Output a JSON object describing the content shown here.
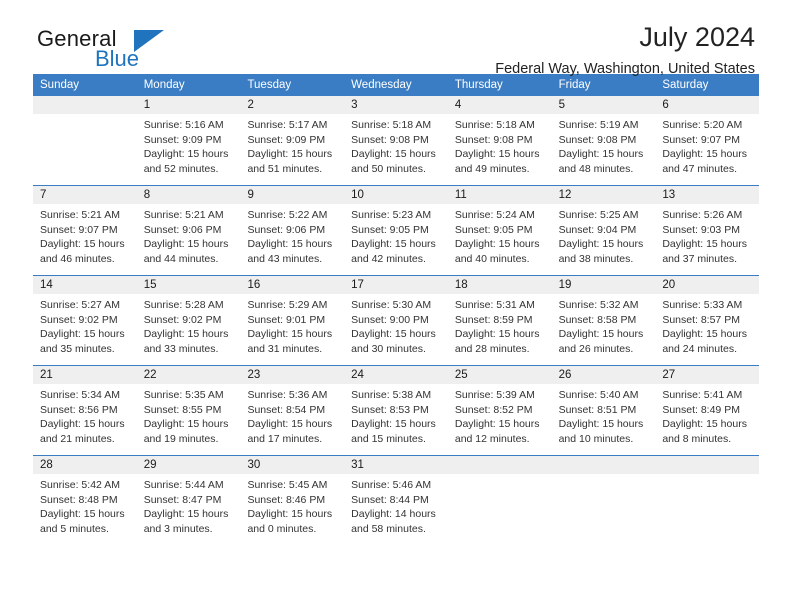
{
  "brand": {
    "name_part1": "General",
    "name_part2": "Blue"
  },
  "header": {
    "month_title": "July 2024",
    "location": "Federal Way, Washington, United States"
  },
  "colors": {
    "header_blue": "#3b7dc4",
    "logo_blue": "#1f74bd",
    "daynum_strip": "#efefef",
    "text": "#333333"
  },
  "weekday_headers": [
    "Sunday",
    "Monday",
    "Tuesday",
    "Wednesday",
    "Thursday",
    "Friday",
    "Saturday"
  ],
  "weeks": [
    [
      {
        "day": "",
        "lines": []
      },
      {
        "day": "1",
        "lines": [
          "Sunrise: 5:16 AM",
          "Sunset: 9:09 PM",
          "Daylight: 15 hours",
          "and 52 minutes."
        ]
      },
      {
        "day": "2",
        "lines": [
          "Sunrise: 5:17 AM",
          "Sunset: 9:09 PM",
          "Daylight: 15 hours",
          "and 51 minutes."
        ]
      },
      {
        "day": "3",
        "lines": [
          "Sunrise: 5:18 AM",
          "Sunset: 9:08 PM",
          "Daylight: 15 hours",
          "and 50 minutes."
        ]
      },
      {
        "day": "4",
        "lines": [
          "Sunrise: 5:18 AM",
          "Sunset: 9:08 PM",
          "Daylight: 15 hours",
          "and 49 minutes."
        ]
      },
      {
        "day": "5",
        "lines": [
          "Sunrise: 5:19 AM",
          "Sunset: 9:08 PM",
          "Daylight: 15 hours",
          "and 48 minutes."
        ]
      },
      {
        "day": "6",
        "lines": [
          "Sunrise: 5:20 AM",
          "Sunset: 9:07 PM",
          "Daylight: 15 hours",
          "and 47 minutes."
        ]
      }
    ],
    [
      {
        "day": "7",
        "lines": [
          "Sunrise: 5:21 AM",
          "Sunset: 9:07 PM",
          "Daylight: 15 hours",
          "and 46 minutes."
        ]
      },
      {
        "day": "8",
        "lines": [
          "Sunrise: 5:21 AM",
          "Sunset: 9:06 PM",
          "Daylight: 15 hours",
          "and 44 minutes."
        ]
      },
      {
        "day": "9",
        "lines": [
          "Sunrise: 5:22 AM",
          "Sunset: 9:06 PM",
          "Daylight: 15 hours",
          "and 43 minutes."
        ]
      },
      {
        "day": "10",
        "lines": [
          "Sunrise: 5:23 AM",
          "Sunset: 9:05 PM",
          "Daylight: 15 hours",
          "and 42 minutes."
        ]
      },
      {
        "day": "11",
        "lines": [
          "Sunrise: 5:24 AM",
          "Sunset: 9:05 PM",
          "Daylight: 15 hours",
          "and 40 minutes."
        ]
      },
      {
        "day": "12",
        "lines": [
          "Sunrise: 5:25 AM",
          "Sunset: 9:04 PM",
          "Daylight: 15 hours",
          "and 38 minutes."
        ]
      },
      {
        "day": "13",
        "lines": [
          "Sunrise: 5:26 AM",
          "Sunset: 9:03 PM",
          "Daylight: 15 hours",
          "and 37 minutes."
        ]
      }
    ],
    [
      {
        "day": "14",
        "lines": [
          "Sunrise: 5:27 AM",
          "Sunset: 9:02 PM",
          "Daylight: 15 hours",
          "and 35 minutes."
        ]
      },
      {
        "day": "15",
        "lines": [
          "Sunrise: 5:28 AM",
          "Sunset: 9:02 PM",
          "Daylight: 15 hours",
          "and 33 minutes."
        ]
      },
      {
        "day": "16",
        "lines": [
          "Sunrise: 5:29 AM",
          "Sunset: 9:01 PM",
          "Daylight: 15 hours",
          "and 31 minutes."
        ]
      },
      {
        "day": "17",
        "lines": [
          "Sunrise: 5:30 AM",
          "Sunset: 9:00 PM",
          "Daylight: 15 hours",
          "and 30 minutes."
        ]
      },
      {
        "day": "18",
        "lines": [
          "Sunrise: 5:31 AM",
          "Sunset: 8:59 PM",
          "Daylight: 15 hours",
          "and 28 minutes."
        ]
      },
      {
        "day": "19",
        "lines": [
          "Sunrise: 5:32 AM",
          "Sunset: 8:58 PM",
          "Daylight: 15 hours",
          "and 26 minutes."
        ]
      },
      {
        "day": "20",
        "lines": [
          "Sunrise: 5:33 AM",
          "Sunset: 8:57 PM",
          "Daylight: 15 hours",
          "and 24 minutes."
        ]
      }
    ],
    [
      {
        "day": "21",
        "lines": [
          "Sunrise: 5:34 AM",
          "Sunset: 8:56 PM",
          "Daylight: 15 hours",
          "and 21 minutes."
        ]
      },
      {
        "day": "22",
        "lines": [
          "Sunrise: 5:35 AM",
          "Sunset: 8:55 PM",
          "Daylight: 15 hours",
          "and 19 minutes."
        ]
      },
      {
        "day": "23",
        "lines": [
          "Sunrise: 5:36 AM",
          "Sunset: 8:54 PM",
          "Daylight: 15 hours",
          "and 17 minutes."
        ]
      },
      {
        "day": "24",
        "lines": [
          "Sunrise: 5:38 AM",
          "Sunset: 8:53 PM",
          "Daylight: 15 hours",
          "and 15 minutes."
        ]
      },
      {
        "day": "25",
        "lines": [
          "Sunrise: 5:39 AM",
          "Sunset: 8:52 PM",
          "Daylight: 15 hours",
          "and 12 minutes."
        ]
      },
      {
        "day": "26",
        "lines": [
          "Sunrise: 5:40 AM",
          "Sunset: 8:51 PM",
          "Daylight: 15 hours",
          "and 10 minutes."
        ]
      },
      {
        "day": "27",
        "lines": [
          "Sunrise: 5:41 AM",
          "Sunset: 8:49 PM",
          "Daylight: 15 hours",
          "and 8 minutes."
        ]
      }
    ],
    [
      {
        "day": "28",
        "lines": [
          "Sunrise: 5:42 AM",
          "Sunset: 8:48 PM",
          "Daylight: 15 hours",
          "and 5 minutes."
        ]
      },
      {
        "day": "29",
        "lines": [
          "Sunrise: 5:44 AM",
          "Sunset: 8:47 PM",
          "Daylight: 15 hours",
          "and 3 minutes."
        ]
      },
      {
        "day": "30",
        "lines": [
          "Sunrise: 5:45 AM",
          "Sunset: 8:46 PM",
          "Daylight: 15 hours",
          "and 0 minutes."
        ]
      },
      {
        "day": "31",
        "lines": [
          "Sunrise: 5:46 AM",
          "Sunset: 8:44 PM",
          "Daylight: 14 hours",
          "and 58 minutes."
        ]
      },
      {
        "day": "",
        "lines": []
      },
      {
        "day": "",
        "lines": []
      },
      {
        "day": "",
        "lines": []
      }
    ]
  ]
}
